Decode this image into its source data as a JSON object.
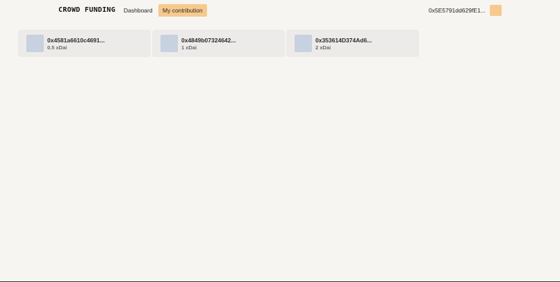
{
  "header": {
    "brand": "CROWD FUNDING",
    "nav": {
      "dashboard": "Dashboard",
      "my_contribution": "My contribution"
    },
    "wallet_address": "0x5E5791dd629fE1...",
    "accent_color": "#f7c98d"
  },
  "contributions": [
    {
      "address": "0x4581a6610c4691...",
      "amount": "0.5 xDai"
    },
    {
      "address": "0x4849b07324642...",
      "amount": "1 xDai"
    },
    {
      "address": "0x353614D374Ad6...",
      "amount": "2 xDai"
    }
  ]
}
